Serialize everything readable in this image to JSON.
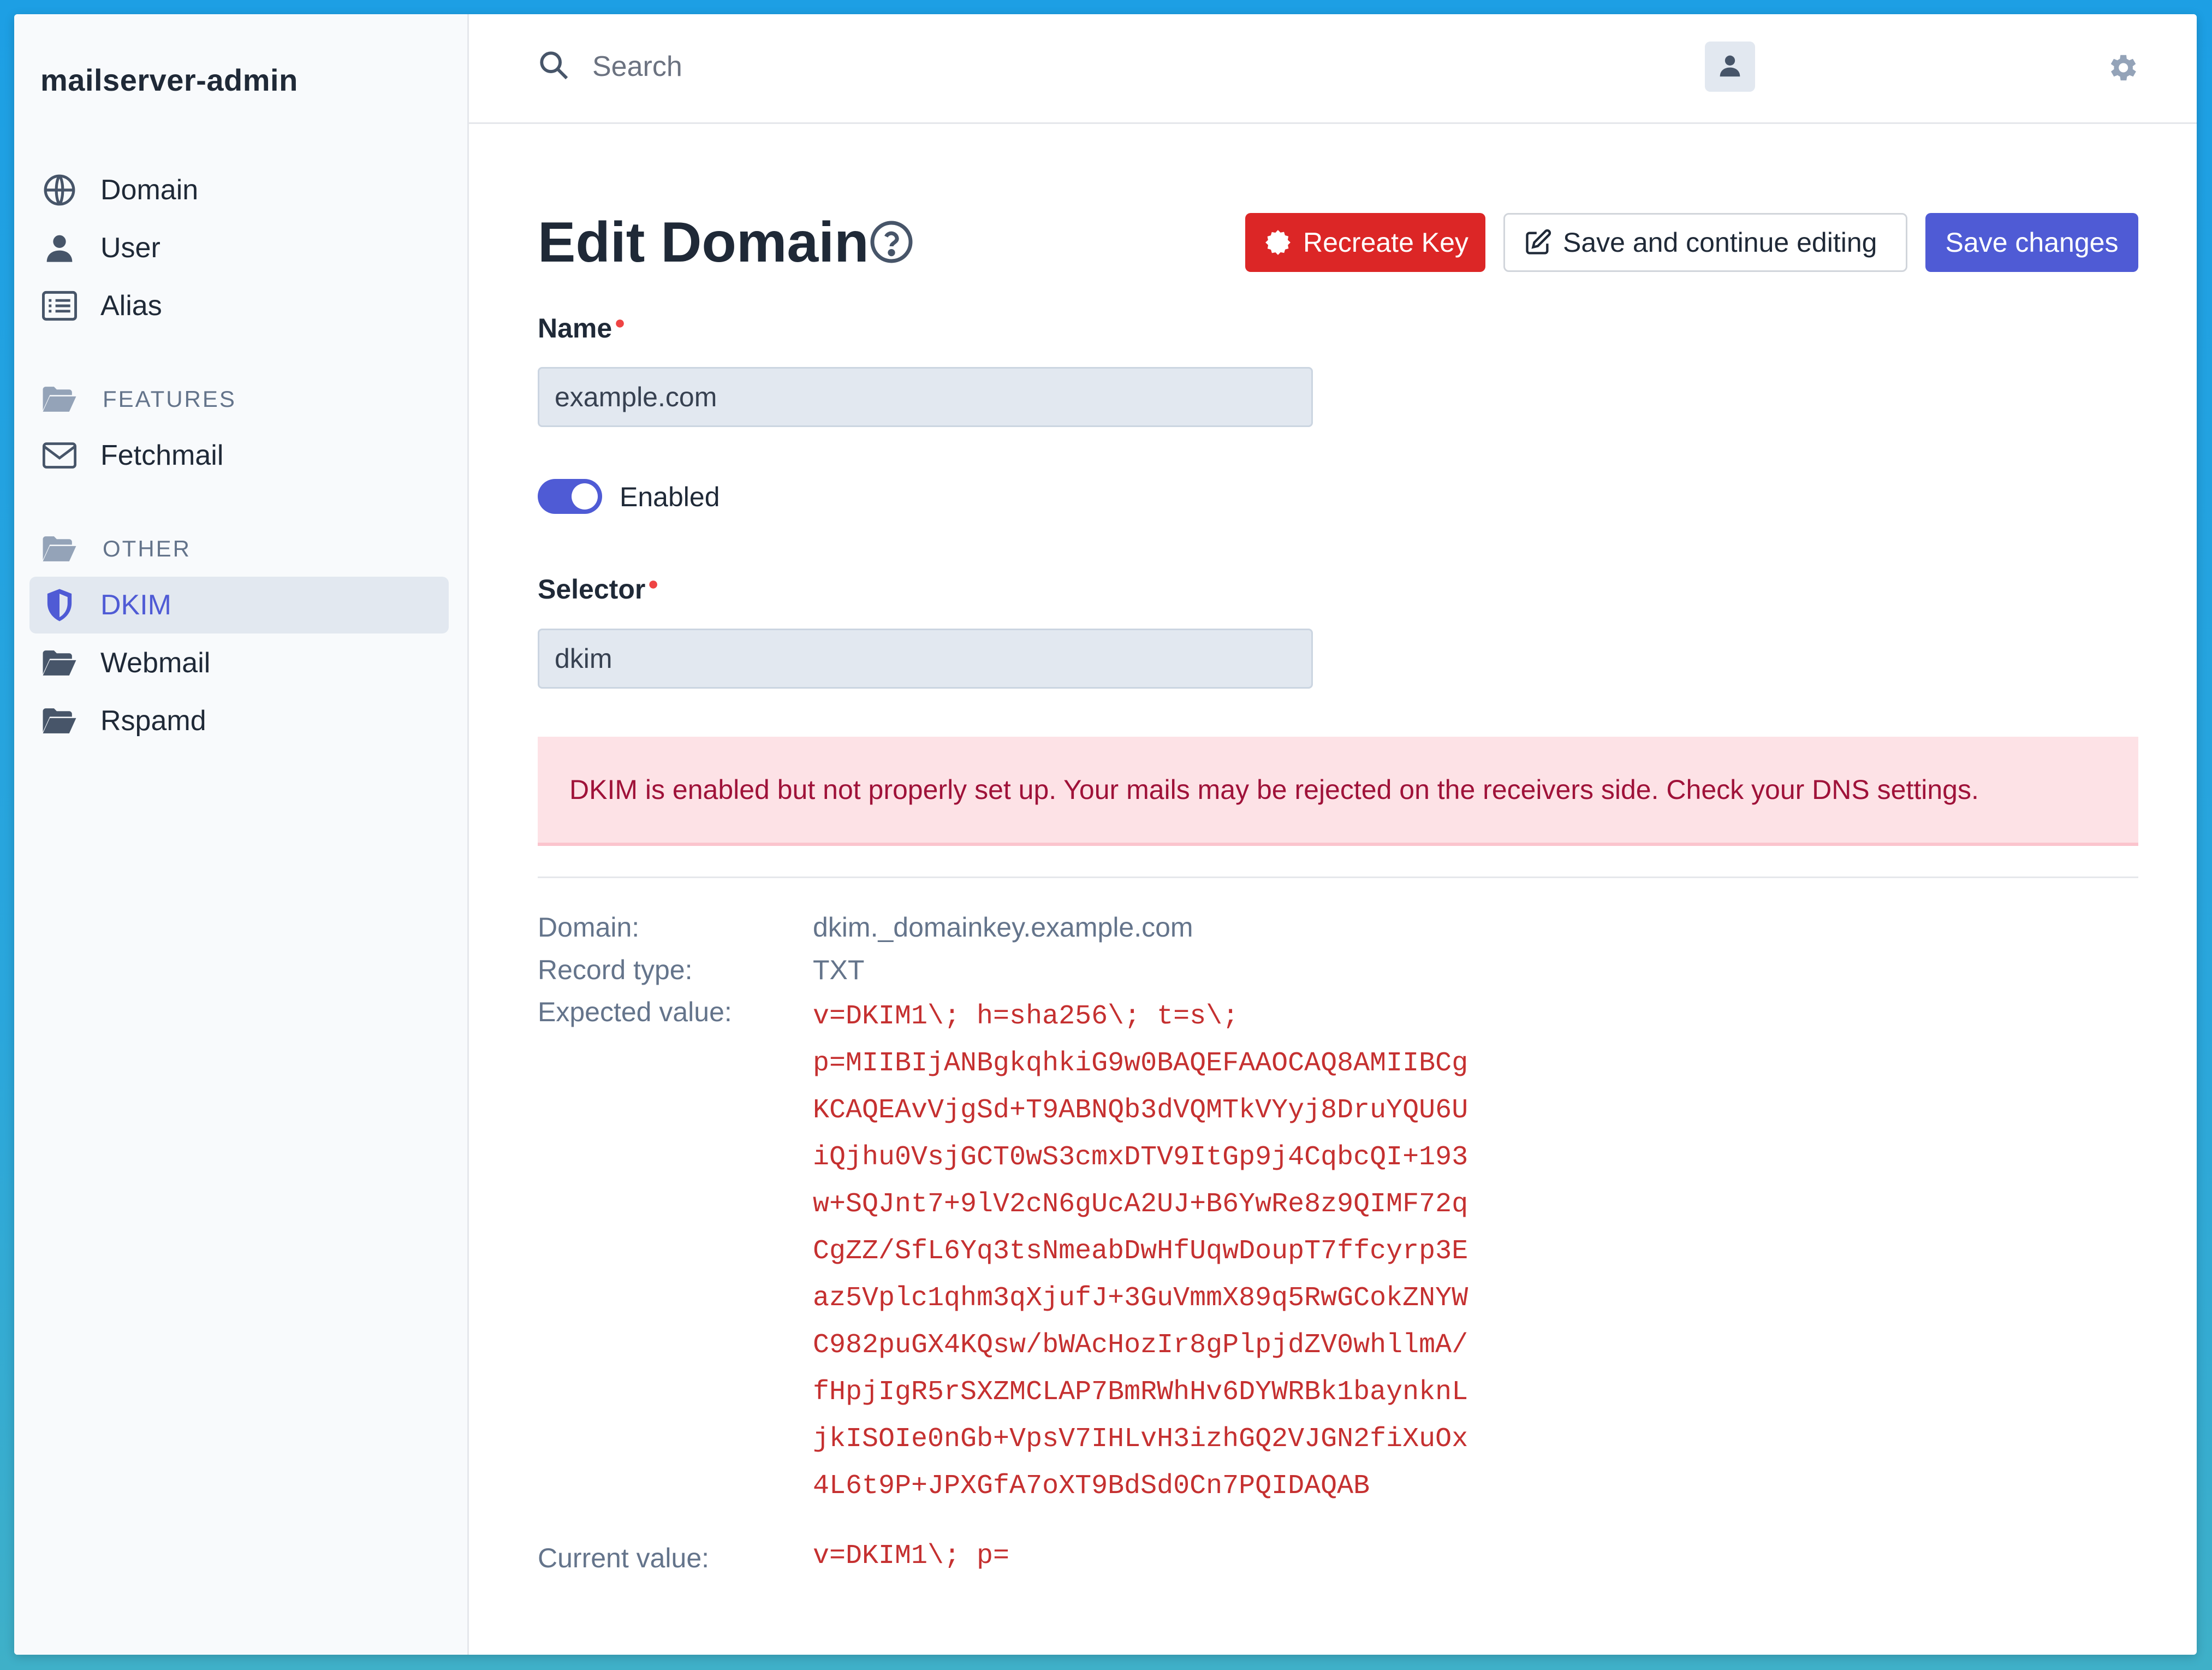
{
  "app": {
    "brand": "mailserver-admin"
  },
  "sidebar": {
    "items": [
      {
        "label": "Domain"
      },
      {
        "label": "User"
      },
      {
        "label": "Alias"
      }
    ],
    "sections": [
      {
        "label": "FEATURES",
        "items": [
          {
            "label": "Fetchmail"
          }
        ]
      },
      {
        "label": "OTHER",
        "items": [
          {
            "label": "DKIM",
            "active": true
          },
          {
            "label": "Webmail"
          },
          {
            "label": "Rspamd"
          }
        ]
      }
    ]
  },
  "header": {
    "search_placeholder": "Search"
  },
  "page": {
    "title": "Edit Domain",
    "buttons": {
      "recreate_key": "Recreate Key",
      "save_continue": "Save and continue editing",
      "save_changes": "Save changes"
    },
    "form": {
      "name_label": "Name",
      "name_value": "example.com",
      "enabled_label": "Enabled",
      "enabled": true,
      "selector_label": "Selector",
      "selector_value": "dkim"
    },
    "alert": "DKIM is enabled but not properly set up. Your mails may be rejected on the receivers side. Check your DNS settings.",
    "dns": {
      "domain_label": "Domain:",
      "domain_value": "dkim._domainkey.example.com",
      "record_type_label": "Record type:",
      "record_type_value": "TXT",
      "expected_label": "Expected value:",
      "expected_lines": [
        "v=DKIM1\\; h=sha256\\; t=s\\;",
        "p=MIIBIjANBgkqhkiG9w0BAQEFAAOCAQ8AMIIBCg",
        "KCAQEAvVjgSd+T9ABNQb3dVQMTkVYyj8DruYQU6U",
        "iQjhu0VsjGCT0wS3cmxDTV9ItGp9j4CqbcQI+193",
        "w+SQJnt7+9lV2cN6gUcA2UJ+B6YwRe8z9QIMF72q",
        "CgZZ/SfL6Yq3tsNmeabDwHfUqwDoupT7ffcyrp3E",
        "az5Vplc1qhm3qXjufJ+3GuVmmX89q5RwGCokZNYW",
        "C982puGX4KQsw/bWAcHozIr8gPlpjdZV0whllmA/",
        "fHpjIgR5rSXZMCLAP7BmRWhHv6DYWRBk1baynknL",
        "jkISOIe0nGb+VpsV7IHLvH3izhGQ2VJGN2fiXuOx",
        "4L6t9P+JPXGfA7oXT9BdSd0Cn7PQIDAQAB"
      ],
      "current_label": "Current value:",
      "current_value": "v=DKIM1\\; p="
    }
  },
  "colors": {
    "accent": "#4f5bd5",
    "danger": "#dc2626",
    "alert_bg": "#fde2e6",
    "alert_text": "#9f1239",
    "code_text": "#c53030"
  }
}
